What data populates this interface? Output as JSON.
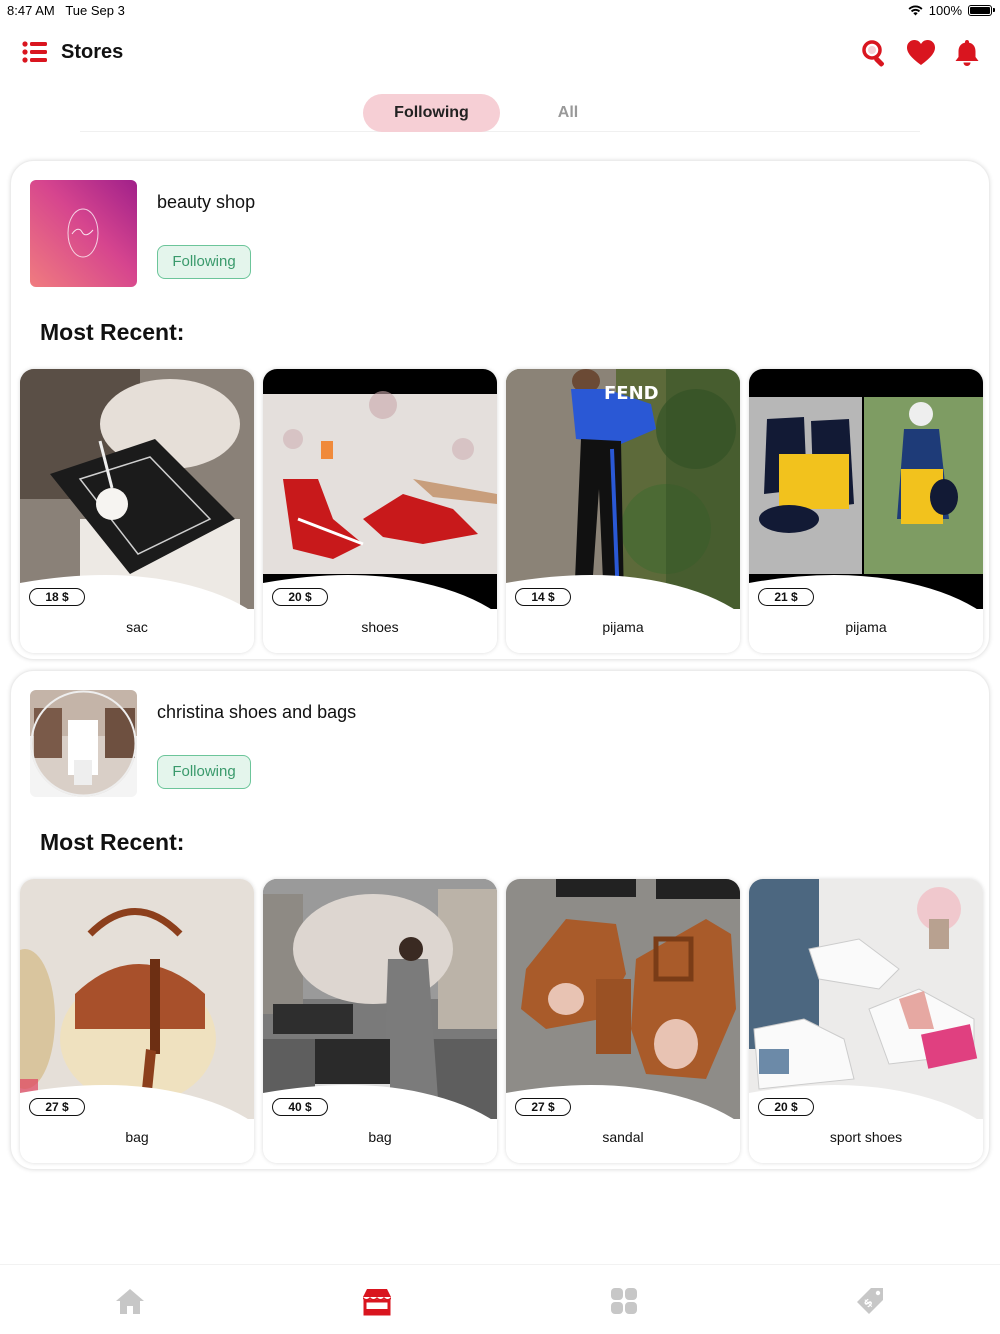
{
  "status_bar": {
    "time": "8:47 AM",
    "date": "Tue Sep 3",
    "battery": "100%"
  },
  "header": {
    "title": "Stores",
    "menu_icon": "list-icon",
    "icons": [
      "search-icon",
      "heart-icon",
      "bell-icon"
    ],
    "accent_color": "#d9151f"
  },
  "tabs": [
    {
      "label": "Following",
      "active": true
    },
    {
      "label": "All",
      "active": false
    }
  ],
  "stores": [
    {
      "name": "beauty shop",
      "follow_label": "Following",
      "section_title": "Most Recent:",
      "products": [
        {
          "name": "sac",
          "price": "18 $"
        },
        {
          "name": "shoes",
          "price": "20 $"
        },
        {
          "name": "pijama",
          "price": "14 $"
        },
        {
          "name": "pijama",
          "price": "21 $"
        }
      ]
    },
    {
      "name": "christina shoes and bags",
      "follow_label": "Following",
      "section_title": "Most Recent:",
      "products": [
        {
          "name": "bag",
          "price": "27 $"
        },
        {
          "name": "bag",
          "price": "40 $"
        },
        {
          "name": "sandal",
          "price": "27 $"
        },
        {
          "name": "sport shoes",
          "price": "20 $"
        }
      ]
    }
  ],
  "bottom_nav": {
    "items": [
      "home-icon",
      "store-icon",
      "grid-icon",
      "tag-icon"
    ],
    "active": "store-icon"
  }
}
